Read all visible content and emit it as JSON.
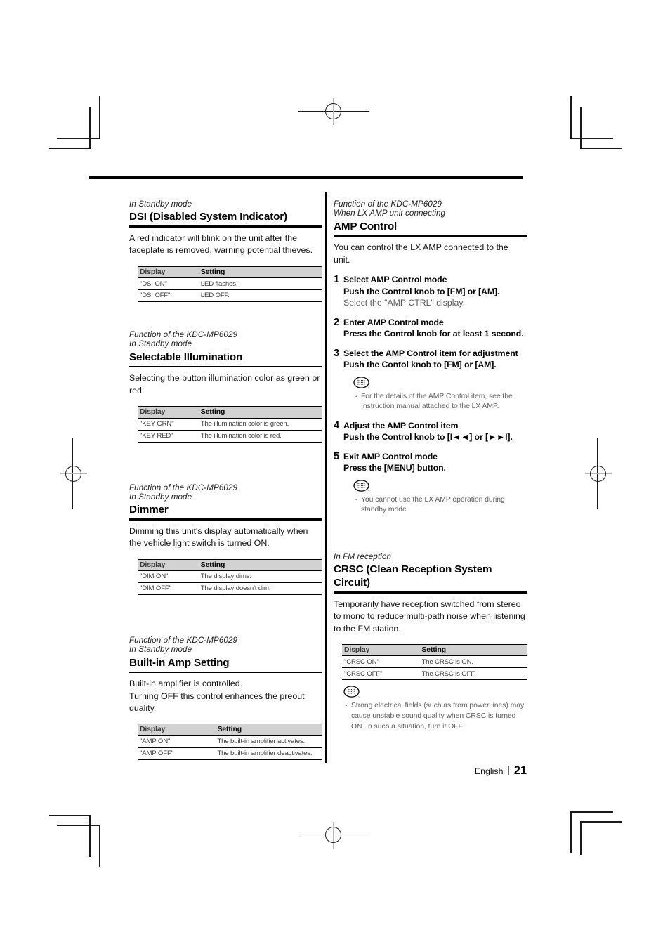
{
  "document": {
    "page_number": "21",
    "language": "English"
  },
  "left_column": {
    "sections": [
      {
        "eyebrow_lines": [
          "In Standby mode"
        ],
        "title": "DSI (Disabled System Indicator)",
        "body": "A red indicator will blink on the unit after the faceplate is removed, warning potential thieves.",
        "table": {
          "headers": [
            "Display",
            "Setting"
          ],
          "setting_indent": "33%",
          "rows": [
            [
              "\"DSI ON\"",
              "LED flashes."
            ],
            [
              "\"DSI OFF\"",
              "LED OFF."
            ]
          ]
        }
      },
      {
        "eyebrow_lines": [
          "Function of the KDC-MP6029",
          "In Standby mode"
        ],
        "title": "Selectable Illumination",
        "body": "Selecting the button illumination color as green or red.",
        "table": {
          "headers": [
            "Display",
            "Setting"
          ],
          "setting_indent": "33%",
          "rows": [
            [
              "\"KEY GRN\"",
              "The illumination color is green."
            ],
            [
              "\"KEY RED\"",
              "The illumination color is red."
            ]
          ]
        }
      },
      {
        "eyebrow_lines": [
          "Function of the KDC-MP6029",
          "In Standby mode"
        ],
        "title": "Dimmer",
        "body": "Dimming this unit's display automatically when the vehicle light switch is turned ON.",
        "table": {
          "headers": [
            "Display",
            "Setting"
          ],
          "setting_indent": "33%",
          "rows": [
            [
              "\"DIM ON\"",
              "The display dims."
            ],
            [
              "\"DIM OFF\"",
              "The display doesn't dim."
            ]
          ]
        }
      },
      {
        "eyebrow_lines": [
          "Function of the KDC-MP6029",
          "In Standby mode"
        ],
        "title": "Built-in Amp Setting",
        "body": "Built-in amplifier is controlled.\nTurning OFF this control enhances the preout quality.",
        "table": {
          "headers": [
            "Display",
            "Setting"
          ],
          "setting_indent": "42%",
          "rows": [
            [
              "\"AMP ON\"",
              "The built-in amplifier activates."
            ],
            [
              "\"AMP OFF\"",
              "The built-in amplifier deactivates."
            ]
          ]
        }
      }
    ]
  },
  "right_column": {
    "amp_control": {
      "eyebrow_lines": [
        "Function of the KDC-MP6029",
        "When LX AMP unit connecting"
      ],
      "title": "AMP Control",
      "body": "You can control the LX AMP connected to the unit.",
      "steps": [
        {
          "num": "1",
          "head": "Select AMP Control mode",
          "sub": "Push the Control knob to [FM] or [AM].",
          "note": "Select the \"AMP CTRL\" display."
        },
        {
          "num": "2",
          "head": "Enter AMP Control mode",
          "sub": "Press the Control knob for at least 1 second.",
          "note": ""
        },
        {
          "num": "3",
          "head": "Select the AMP Control item for adjustment",
          "sub": "Push the Contol knob to [FM] or [AM].",
          "note": "",
          "memo": [
            "For the details of the AMP Control item, see the Instruction manual attached to the LX AMP."
          ]
        },
        {
          "num": "4",
          "head": "Adjust the AMP Control item",
          "sub": "Push the Control knob to [I◄◄] or [►►I].",
          "note": ""
        },
        {
          "num": "5",
          "head": "Exit AMP Control mode",
          "sub": "Press the [MENU] button.",
          "note": "",
          "memo": [
            "You cannot use the LX AMP operation during standby mode."
          ]
        }
      ]
    },
    "crsc": {
      "eyebrow_lines": [
        "In FM reception"
      ],
      "title": "CRSC (Clean Reception System Circuit)",
      "body": "Temporarily have reception switched from stereo to mono to reduce multi-path noise when listening to the FM station.",
      "table": {
        "headers": [
          "Display",
          "Setting"
        ],
        "setting_indent": "42%",
        "rows": [
          [
            "\"CRSC ON\"",
            "The CRSC is ON."
          ],
          [
            "\"CRSC OFF\"",
            "The CRSC is OFF."
          ]
        ]
      },
      "memo": [
        "Strong electrical fields (such as from power lines) may cause unstable sound quality when CRSC is turned ON. In such a situation, turn it OFF."
      ]
    }
  },
  "icons": {
    "memo": "speech-bubble-note-icon",
    "registration": "registration-target-mark"
  }
}
